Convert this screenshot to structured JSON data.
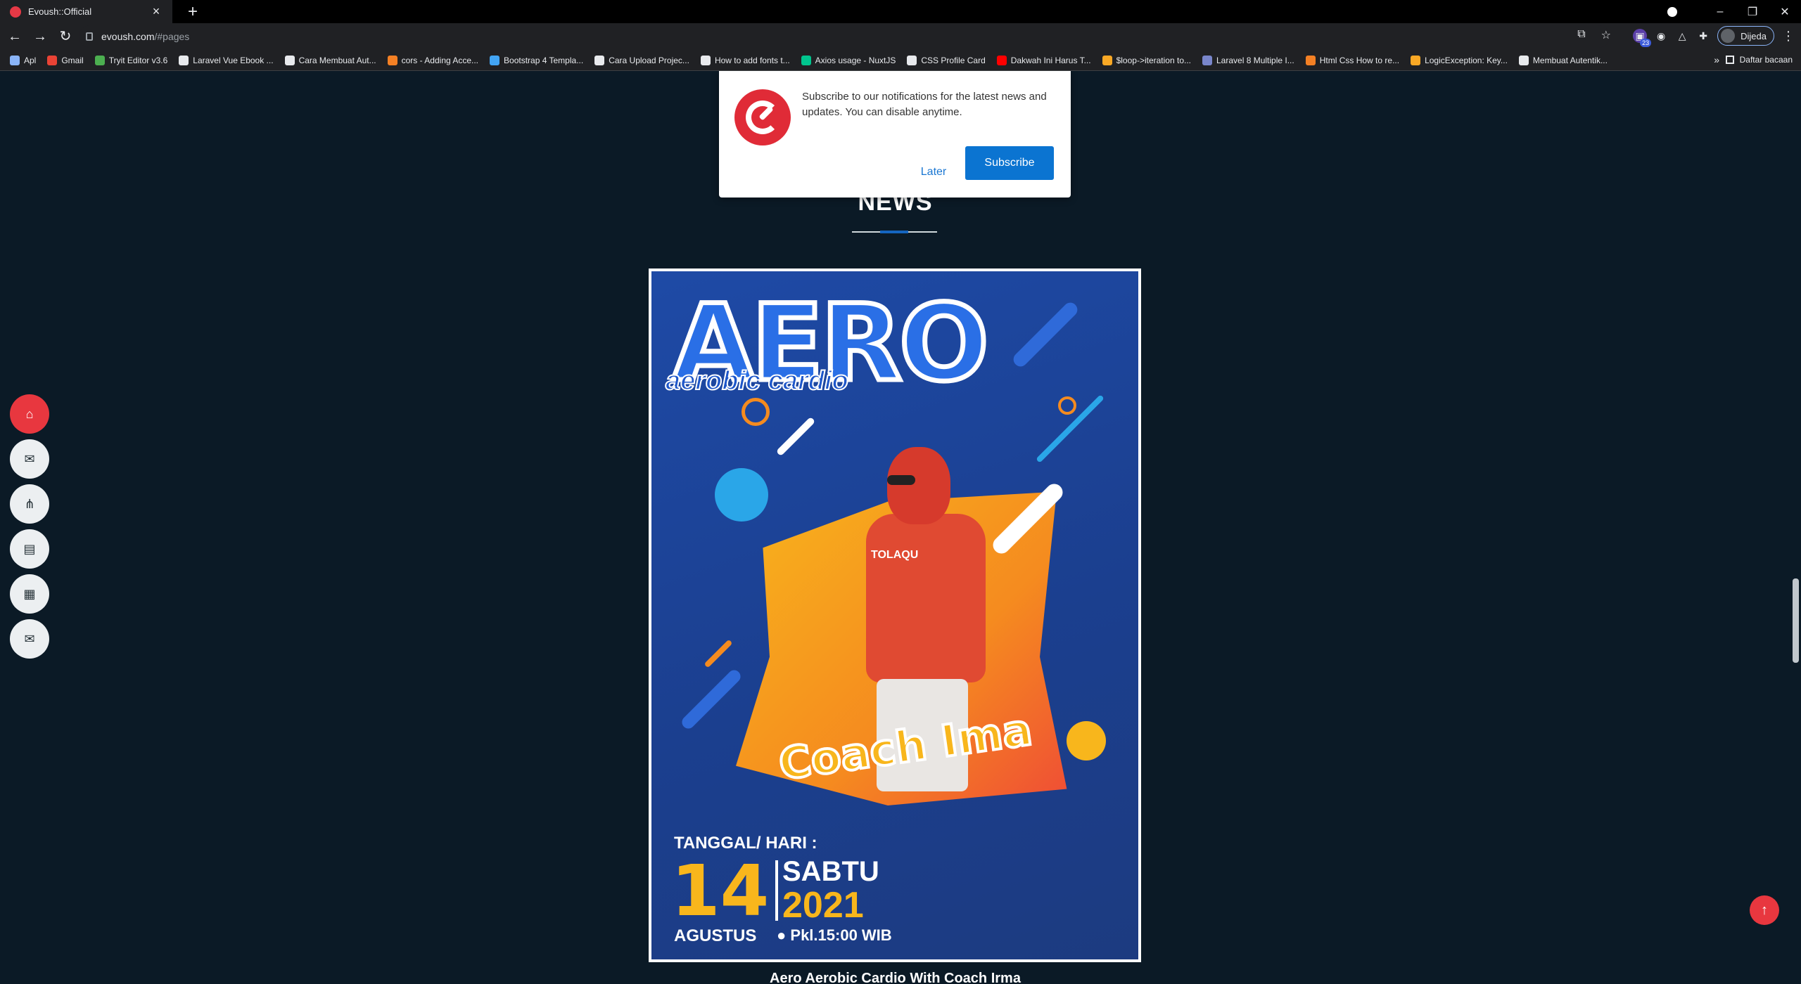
{
  "browser": {
    "tab_title": "Evoush::Official",
    "url_host": "evoush.com",
    "url_path": "/#pages",
    "profile_label": "Dijeda",
    "ext_badge": "23",
    "bookmarks": [
      {
        "label": "Apl",
        "color": "#8ab4f8"
      },
      {
        "label": "Gmail",
        "color": "#ea4335"
      },
      {
        "label": "Tryit Editor v3.6",
        "color": "#4caf50"
      },
      {
        "label": "Laravel Vue Ebook ...",
        "color": "#e8eaed"
      },
      {
        "label": "Cara Membuat Aut...",
        "color": "#e8eaed"
      },
      {
        "label": "cors - Adding Acce...",
        "color": "#f48024"
      },
      {
        "label": "Bootstrap 4 Templa...",
        "color": "#42a5f5"
      },
      {
        "label": "Cara Upload Projec...",
        "color": "#e8eaed"
      },
      {
        "label": "How to add fonts t...",
        "color": "#e8eaed"
      },
      {
        "label": "Axios usage - NuxtJS",
        "color": "#00c58e"
      },
      {
        "label": "CSS Profile Card",
        "color": "#e8eaed"
      },
      {
        "label": "Dakwah Ini Harus T...",
        "color": "#ff0000"
      },
      {
        "label": "$loop->iteration to...",
        "color": "#f9a825"
      },
      {
        "label": "Laravel 8 Multiple I...",
        "color": "#7986cb"
      },
      {
        "label": "Html Css How to re...",
        "color": "#f48024"
      },
      {
        "label": "LogicException: Key...",
        "color": "#f9a825"
      },
      {
        "label": "Membuat Autentik...",
        "color": "#e8eaed"
      }
    ],
    "reading_list": "Daftar bacaan"
  },
  "popup": {
    "message": "Subscribe to our notifications for the latest news and updates. You can disable anytime.",
    "later_label": "Later",
    "subscribe_label": "Subscribe"
  },
  "section": {
    "title": "NEWS"
  },
  "news_item": {
    "poster": {
      "headline": "AERO",
      "subheadline": "aerobic cardio",
      "shirt_text": "TOLAQU",
      "coach": "Coach Ima",
      "date_label": "TANGGAL/ HARI :",
      "day": "14",
      "weekday": "SABTU",
      "year": "2021",
      "month": "AGUSTUS",
      "time": "● Pkl.15:00 WIB"
    },
    "caption": "Aero Aerobic Cardio With Coach Irma"
  },
  "sidenav": [
    {
      "icon": "home-icon",
      "active": true
    },
    {
      "icon": "envelope-open-icon",
      "active": false
    },
    {
      "icon": "network-icon",
      "active": false
    },
    {
      "icon": "newspaper-icon",
      "active": false
    },
    {
      "icon": "grid-icon",
      "active": false
    },
    {
      "icon": "mail-icon",
      "active": false
    }
  ],
  "colors": {
    "accent_red": "#e8373f",
    "page_bg": "#0b1a26",
    "subscribe_blue": "#0b74d1"
  }
}
